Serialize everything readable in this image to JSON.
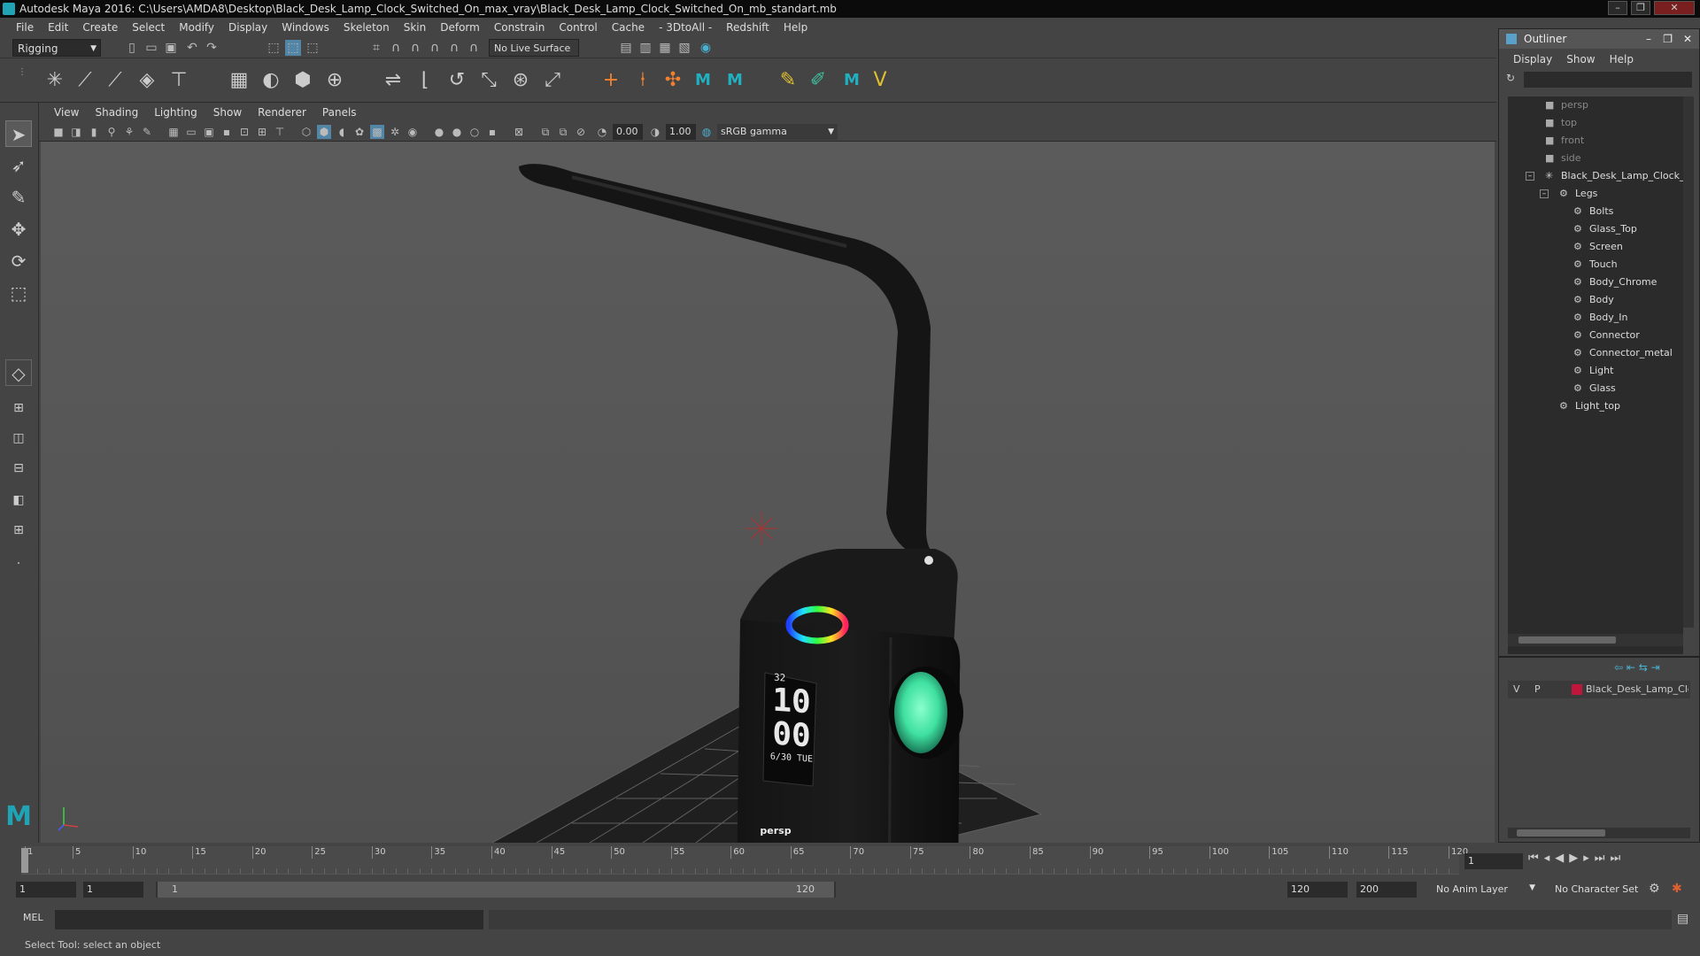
{
  "window": {
    "title": "Autodesk Maya 2016: C:\\Users\\AMDA8\\Desktop\\Black_Desk_Lamp_Clock_Switched_On_max_vray\\Black_Desk_Lamp_Clock_Switched_On_mb_standart.mb"
  },
  "menubar": [
    "File",
    "Edit",
    "Create",
    "Select",
    "Modify",
    "Display",
    "Windows",
    "Skeleton",
    "Skin",
    "Deform",
    "Constrain",
    "Control",
    "Cache",
    "- 3DtoAll -",
    "Redshift",
    "Help"
  ],
  "toolbar": {
    "mode": "Rigging",
    "live_surface": "No Live Surface"
  },
  "panel_menu": [
    "View",
    "Shading",
    "Lighting",
    "Show",
    "Renderer",
    "Panels"
  ],
  "panel_toolbar": {
    "exposure": "0.00",
    "gamma": "1.00",
    "color_space": "sRGB gamma"
  },
  "viewport": {
    "camera_label": "persp",
    "clock_digits_top": "10",
    "clock_digits_bottom": "00",
    "clock_date": "6/30 TUE",
    "clock_temp": "32"
  },
  "outliner": {
    "title": "Outliner",
    "menu": [
      "Display",
      "Show",
      "Help"
    ],
    "items": [
      {
        "label": "persp",
        "indent": 0,
        "type": "camera"
      },
      {
        "label": "top",
        "indent": 0,
        "type": "camera"
      },
      {
        "label": "front",
        "indent": 0,
        "type": "camera"
      },
      {
        "label": "side",
        "indent": 0,
        "type": "camera"
      },
      {
        "label": "Black_Desk_Lamp_Clock_Sw",
        "indent": 0,
        "type": "root"
      },
      {
        "label": "Legs",
        "indent": 1,
        "type": "group"
      },
      {
        "label": "Bolts",
        "indent": 2,
        "type": "mesh"
      },
      {
        "label": "Glass_Top",
        "indent": 2,
        "type": "mesh"
      },
      {
        "label": "Screen",
        "indent": 2,
        "type": "mesh"
      },
      {
        "label": "Touch",
        "indent": 2,
        "type": "mesh"
      },
      {
        "label": "Body_Chrome",
        "indent": 2,
        "type": "mesh"
      },
      {
        "label": "Body",
        "indent": 2,
        "type": "mesh"
      },
      {
        "label": "Body_In",
        "indent": 2,
        "type": "mesh"
      },
      {
        "label": "Connector",
        "indent": 2,
        "type": "mesh"
      },
      {
        "label": "Connector_metal",
        "indent": 2,
        "type": "mesh"
      },
      {
        "label": "Light",
        "indent": 2,
        "type": "mesh"
      },
      {
        "label": "Glass",
        "indent": 2,
        "type": "mesh"
      },
      {
        "label": "Light_top",
        "indent": 1,
        "type": "mesh"
      }
    ]
  },
  "layers": {
    "v": "V",
    "p": "P",
    "name": "Black_Desk_Lamp_Cloc",
    "color": "#c0163c"
  },
  "timeline": {
    "ticks": [
      "1",
      "5",
      "10",
      "15",
      "20",
      "25",
      "30",
      "35",
      "40",
      "45",
      "50",
      "55",
      "60",
      "65",
      "70",
      "75",
      "80",
      "85",
      "90",
      "95",
      "100",
      "105",
      "110",
      "115",
      "120"
    ],
    "current_frame": "1"
  },
  "range": {
    "start": "1",
    "playback_start": "1",
    "slider_start": "1",
    "slider_end": "120",
    "playback_end": "120",
    "end": "200",
    "anim_layer": "No Anim Layer",
    "char_set": "No Character Set"
  },
  "cmdline": {
    "label": "MEL"
  },
  "status": {
    "text": "Select Tool: select an object"
  },
  "colors": {
    "maya_teal": "#1fa3b5",
    "lamp_glow": "#3fe0a0"
  }
}
